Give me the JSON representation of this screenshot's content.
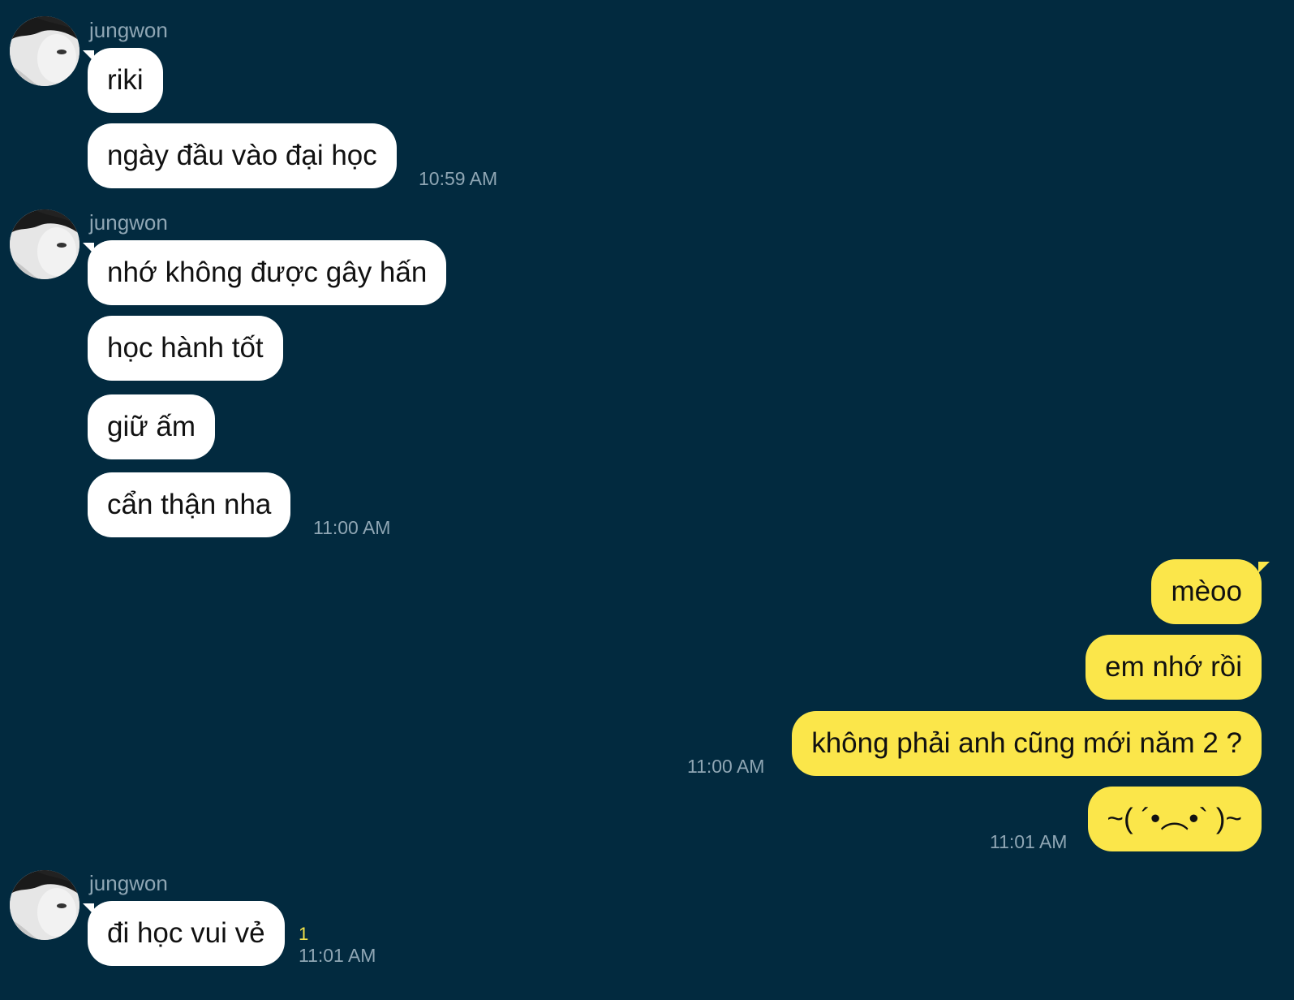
{
  "groups": [
    {
      "sender": "jungwon",
      "messages": [
        "riki",
        "ngày đầu vào đại học"
      ],
      "time": "10:59 AM"
    },
    {
      "sender": "jungwon",
      "messages": [
        "nhớ không được gây hấn",
        "học hành tốt",
        "giữ ấm",
        "cẩn thận nha"
      ],
      "time": "11:00 AM"
    },
    {
      "outgoing": true,
      "messages": [
        "mèoo",
        "em nhớ rồi",
        "không phải anh cũng mới năm 2 ?",
        "~( ´•︵•` )~"
      ],
      "times": [
        "11:00 AM",
        "11:01 AM"
      ]
    },
    {
      "sender": "jungwon",
      "messages": [
        "đi học vui vẻ"
      ],
      "time": "11:01 AM",
      "unread_count": "1"
    }
  ],
  "colors": {
    "background": "#022a3f",
    "incoming_bubble": "#ffffff",
    "outgoing_bubble": "#fbe64a",
    "meta_text": "#8fa6b4",
    "unread_badge": "#f4e34a"
  }
}
